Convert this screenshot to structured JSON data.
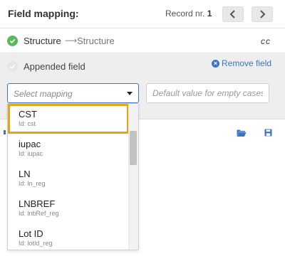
{
  "header": {
    "title": "Field mapping:",
    "record_label": "Record nr.",
    "record_number": "1"
  },
  "structure_row": {
    "source": "Structure",
    "arrow": "⟶",
    "target": "Structure",
    "type_code": "cc"
  },
  "appended": {
    "label": "Appended field",
    "remove_label": "Remove field",
    "select_placeholder": "Select mapping",
    "default_placeholder": "Default value for empty cases"
  },
  "dropdown": {
    "items": [
      {
        "label": "CST",
        "id": "Id: cst"
      },
      {
        "label": "iupac",
        "id": "Id: iupac"
      },
      {
        "label": "LN",
        "id": "Id: ln_reg"
      },
      {
        "label": "LNBREF",
        "id": "Id: lnbRef_reg"
      },
      {
        "label": "Lot ID",
        "id": "Id: lotId_reg"
      }
    ]
  },
  "colors": {
    "accent": "#3a76c4",
    "success": "#5cb85c",
    "highlight": "#e6a417"
  },
  "icons": {
    "check": "check-circle-icon",
    "remove": "remove-circle-icon",
    "folder": "folder-open-icon",
    "save": "save-icon"
  }
}
